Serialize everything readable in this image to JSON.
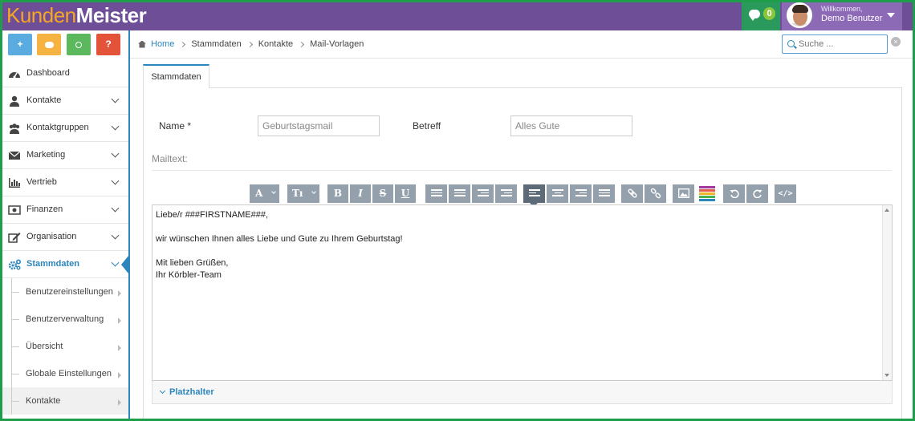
{
  "app": {
    "logo_part1": "Kunden",
    "logo_part2": "Meister",
    "messages_count": "0",
    "user_welcome": "Willkommen,",
    "user_name": "Demo Benutzer"
  },
  "quick_actions": [
    {
      "label": "+",
      "icon": "plus-icon",
      "color": "#5aace0"
    },
    {
      "label": "▬",
      "icon": "chat-icon",
      "color": "#f5b441"
    },
    {
      "label": "⌕",
      "icon": "search-icon",
      "color": "#5cb85c"
    },
    {
      "label": "?",
      "icon": "help-icon",
      "color": "#e2533a"
    }
  ],
  "nav": {
    "items": [
      {
        "label": "Dashboard",
        "icon": "dashboard-icon"
      },
      {
        "label": "Kontakte",
        "icon": "user-icon"
      },
      {
        "label": "Kontaktgruppen",
        "icon": "users-icon"
      },
      {
        "label": "Marketing",
        "icon": "envelope-icon"
      },
      {
        "label": "Vertrieb",
        "icon": "bar-chart-icon"
      },
      {
        "label": "Finanzen",
        "icon": "money-icon"
      },
      {
        "label": "Organisation",
        "icon": "edit-icon"
      },
      {
        "label": "Stammdaten",
        "icon": "cogs-icon"
      }
    ],
    "sub_items": [
      {
        "label": "Benutzereinstellungen"
      },
      {
        "label": "Benutzerverwaltung"
      },
      {
        "label": "Übersicht"
      },
      {
        "label": "Globale Einstellungen"
      },
      {
        "label": "Kontakte"
      }
    ]
  },
  "breadcrumb": [
    "Home",
    "Stammdaten",
    "Kontakte",
    "Mail-Vorlagen"
  ],
  "search": {
    "placeholder": "Suche ..."
  },
  "tab": {
    "label": "Stammdaten"
  },
  "form": {
    "name_label": "Name *",
    "name_value": "Geburtstagsmail",
    "betreff_label": "Betreff",
    "betreff_value": "Alles Gute",
    "mailtext_label": "Mailtext:"
  },
  "toolbar": {
    "font_label": "A",
    "size_label": "Tı",
    "bold": "B",
    "italic": "I",
    "strike": "S",
    "underline": "U"
  },
  "editor": {
    "lines": [
      "Liebe/r ###FIRSTNAME###,",
      "wir wünschen Ihnen alles Liebe und Gute zu Ihrem Geburtstag!",
      "Mit lieben Grüßen,",
      "Ihr Körbler-Team"
    ]
  },
  "placeholder_section": {
    "label": "Platzhalter"
  }
}
